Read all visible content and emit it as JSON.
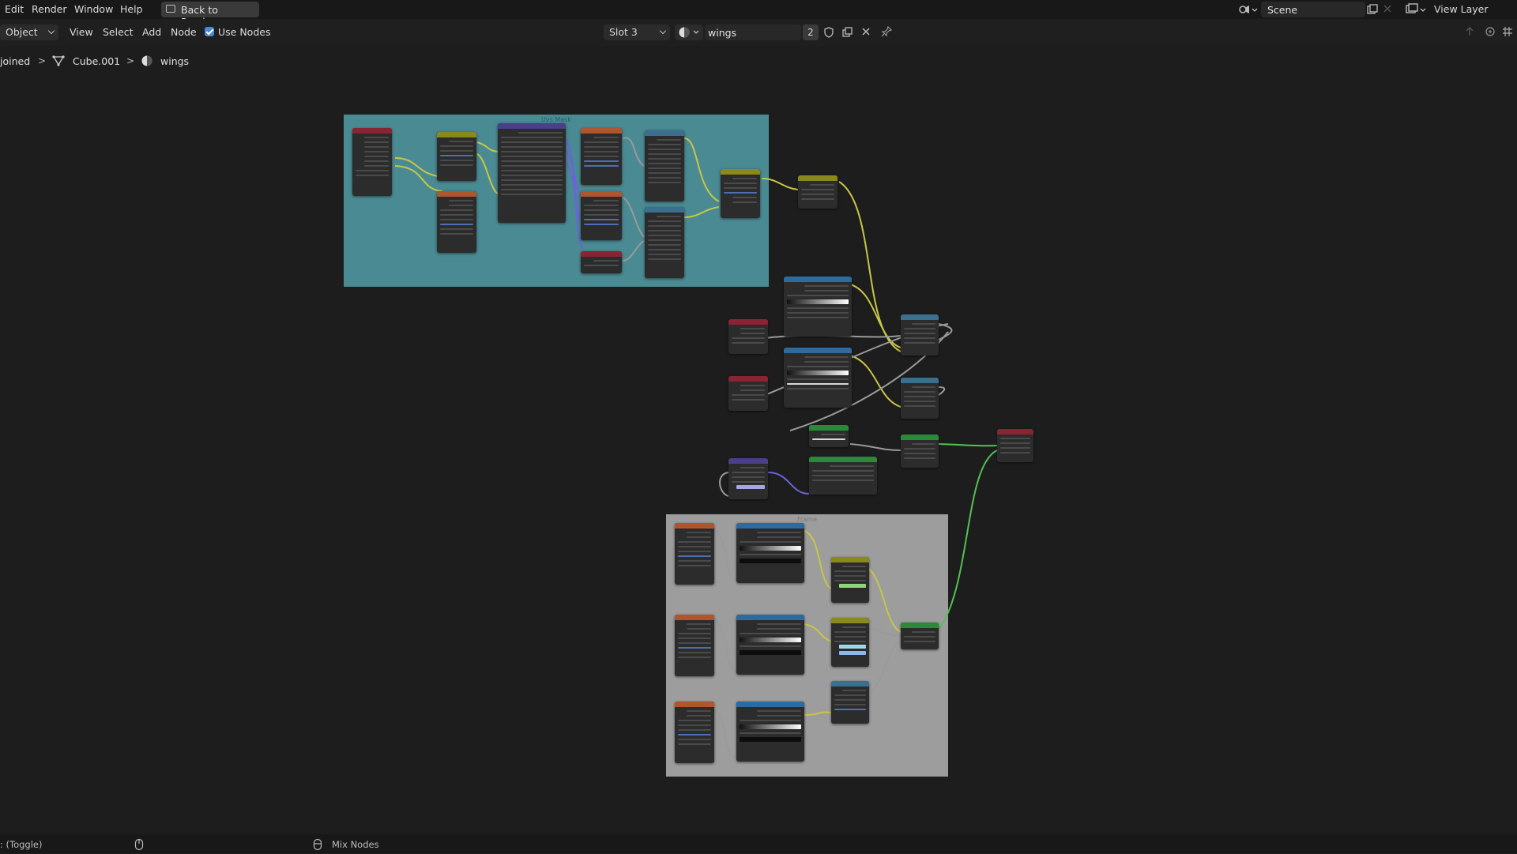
{
  "menubar": {
    "items": [
      "Edit",
      "Render",
      "Window",
      "Help"
    ],
    "back_button": "Back to Previous",
    "scene": "Scene",
    "view_layer": "View Layer"
  },
  "header": {
    "mode": "Object",
    "menus": [
      "View",
      "Select",
      "Add",
      "Node"
    ],
    "use_nodes_label": "Use Nodes",
    "slot": "Slot 3",
    "material_name": "wings",
    "user_count": "2"
  },
  "breadcrumb": {
    "object": "joined",
    "mesh": "Cube.001",
    "material": "wings"
  },
  "frames": {
    "uv_frame_label": "Uvs Mask",
    "bottom_frame_label": "Frame"
  },
  "statusbar": {
    "left_hint": ": (Toggle)",
    "mix_nodes": "Mix Nodes"
  },
  "icons": {
    "back": "screen-back-icon",
    "scene": "scene-icon",
    "view_layer": "view-layer-icon",
    "material": "material-sphere-icon",
    "mesh": "mesh-data-icon",
    "pin": "pin-icon",
    "mouse": "mouse-icon"
  },
  "colors": {
    "frame_uv": "#4a8a93",
    "frame_bottom": "#9d9d9d",
    "node_texture_header": "#b0562c",
    "node_color_header": "#2d6a9e",
    "node_vector_header": "#4a3f8a",
    "node_converter_header": "#3a6f8e",
    "node_shader_header": "#2a8a3a",
    "node_input_header": "#8a2433",
    "node_mix_header": "#8a8a1c",
    "link_yellow": "#c8c646",
    "link_green": "#53c253",
    "link_gray": "#9a9a9a",
    "link_purple": "#6b63d8",
    "checkbox_blue": "#4a89d8"
  }
}
